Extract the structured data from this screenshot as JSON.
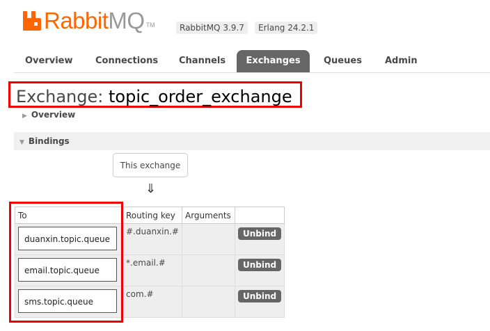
{
  "header": {
    "logo_rabbit": "Rabbit",
    "logo_mq": "MQ",
    "logo_tm": "TM",
    "rabbitmq_version": "RabbitMQ 3.9.7",
    "erlang_version": "Erlang 24.2.1"
  },
  "tabs": [
    {
      "label": "Overview"
    },
    {
      "label": "Connections"
    },
    {
      "label": "Channels"
    },
    {
      "label": "Exchanges",
      "active": true
    },
    {
      "label": "Queues"
    },
    {
      "label": "Admin"
    }
  ],
  "page": {
    "title_prefix": "Exchange: ",
    "exchange_name": "topic_order_exchange"
  },
  "sections": {
    "overview": "Overview",
    "bindings": "Bindings"
  },
  "bindings": {
    "this_exchange": "This exchange",
    "arrow": "⇓",
    "columns": {
      "to": "To",
      "routing_key": "Routing key",
      "arguments": "Arguments",
      "actions": ""
    },
    "rows": [
      {
        "to": "duanxin.topic.queue",
        "routing_key": "#.duanxin.#",
        "arguments": "",
        "action": "Unbind"
      },
      {
        "to": "email.topic.queue",
        "routing_key": "*.email.#",
        "arguments": "",
        "action": "Unbind"
      },
      {
        "to": "sms.topic.queue",
        "routing_key": "com.#",
        "arguments": "",
        "action": "Unbind"
      }
    ]
  },
  "colors": {
    "accent": "#ff6600",
    "highlight_box": "#ee0000",
    "active_tab": "#666666"
  }
}
